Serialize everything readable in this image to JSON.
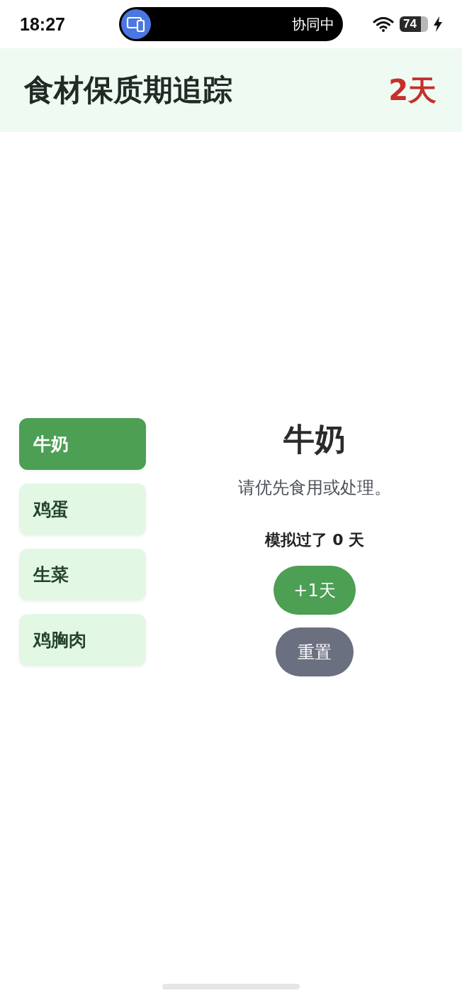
{
  "status_bar": {
    "time": "18:27",
    "island": {
      "label": "协同中"
    },
    "battery": "74"
  },
  "header": {
    "title": "食材保质期追踪",
    "days_left": "2天"
  },
  "foods": [
    {
      "name": "牛奶",
      "selected": true
    },
    {
      "name": "鸡蛋",
      "selected": false
    },
    {
      "name": "生菜",
      "selected": false
    },
    {
      "name": "鸡胸肉",
      "selected": false
    }
  ],
  "detail": {
    "name": "牛奶",
    "advice": "请优先食用或处理。",
    "simulated": "模拟过了 0 天"
  },
  "buttons": [
    {
      "label": "+1天",
      "kind": "primary"
    },
    {
      "label": "重置",
      "kind": "secondary"
    }
  ]
}
